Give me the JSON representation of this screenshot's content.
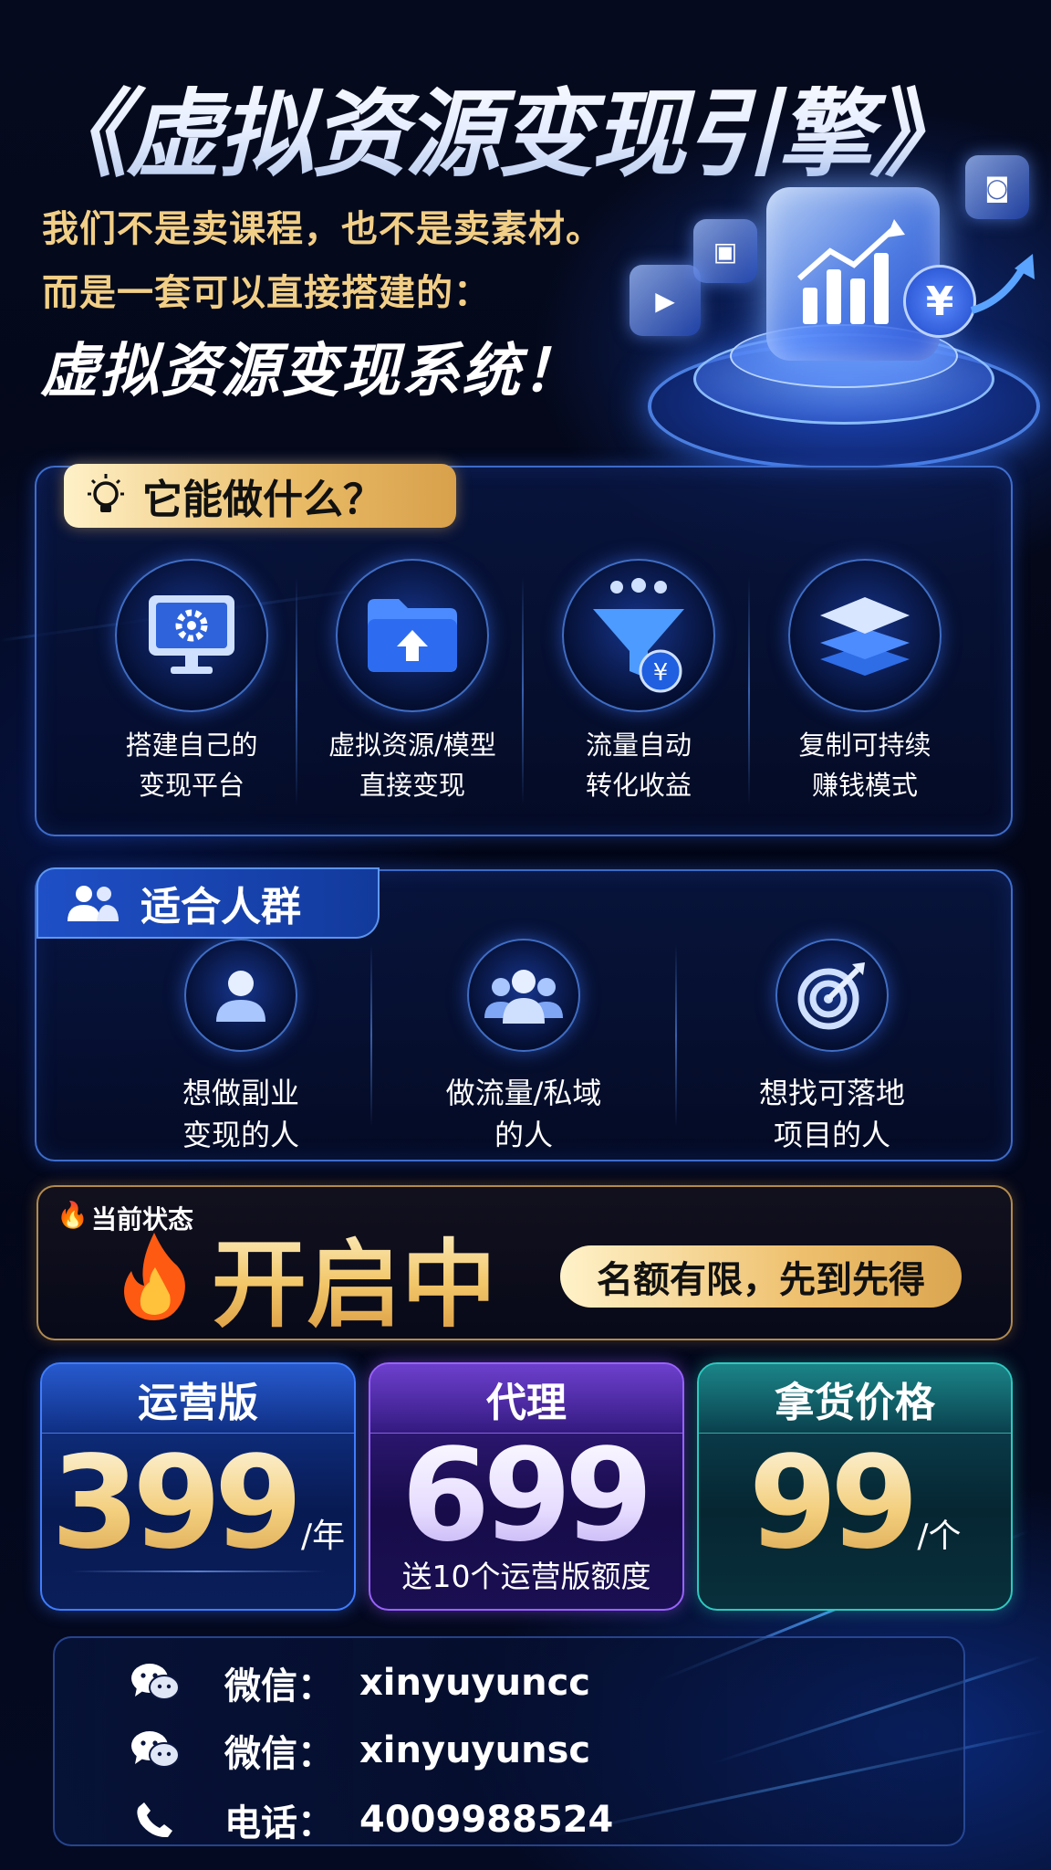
{
  "header": {
    "title": "《虚拟资源变现引擎》",
    "sub_line1": "我们不是卖课程，也不是卖素材。",
    "sub_line2": "而是一套可以直接搭建的：",
    "slogan": "虚拟资源变现系统！"
  },
  "hero": {
    "currency_symbol": "¥"
  },
  "features": {
    "heading": "它能做什么？",
    "icon": "lightbulb-icon",
    "items": [
      {
        "icon": "monitor-gear-icon",
        "line1": "搭建自己的",
        "line2": "变现平台"
      },
      {
        "icon": "folder-upload-icon",
        "line1": "虚拟资源/模型",
        "line2": "直接变现"
      },
      {
        "icon": "funnel-yuan-icon",
        "line1": "流量自动",
        "line2": "转化收益"
      },
      {
        "icon": "layers-icon",
        "line1": "复制可持续",
        "line2": "赚钱模式"
      }
    ]
  },
  "audience": {
    "heading": "适合人群",
    "icon": "group-icon",
    "items": [
      {
        "icon": "user-icon",
        "line1": "想做副业",
        "line2": "变现的人"
      },
      {
        "icon": "users-icon",
        "line1": "做流量/私域",
        "line2": "的人"
      },
      {
        "icon": "target-icon",
        "line1": "想找可落地",
        "line2": "项目的人"
      }
    ]
  },
  "status": {
    "label": "当前状态",
    "value": "开启中",
    "pill": "名额有限，先到先得"
  },
  "pricing": [
    {
      "name": "运营版",
      "value": "399",
      "unit": "/年",
      "note": "",
      "accent": "#2f6bff"
    },
    {
      "name": "代理",
      "value": "699",
      "unit": "",
      "note": "送10个运营版额度",
      "accent": "#8a4dff"
    },
    {
      "name": "拿货价格",
      "value": "99",
      "unit": "/个",
      "note": "",
      "accent": "#1fb6b0"
    }
  ],
  "contact": [
    {
      "icon": "wechat-icon",
      "label": "微信：",
      "value": "xinyuyuncc"
    },
    {
      "icon": "wechat-icon",
      "label": "微信：",
      "value": "xinyuyunsc"
    },
    {
      "icon": "phone-icon",
      "label": "电话：",
      "value": "4009988524"
    }
  ]
}
